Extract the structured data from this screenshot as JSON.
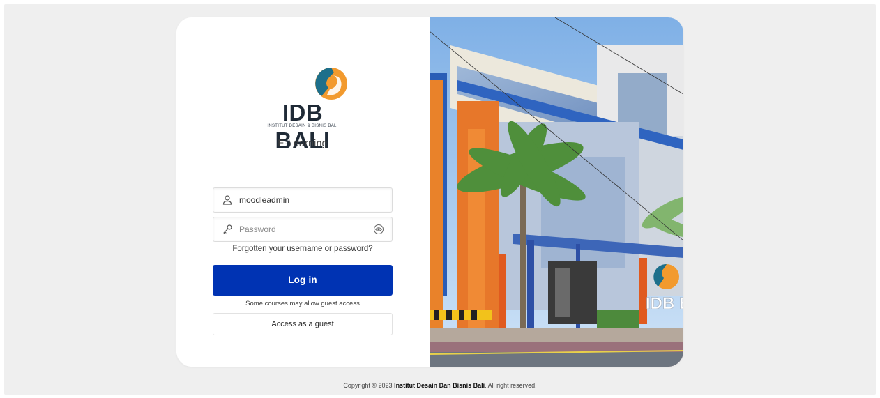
{
  "brand": {
    "title": "IDB BALI",
    "subtitle": "INSTITUT DESAIN & BISNIS BALI",
    "app_name": "E-Learning",
    "colors": {
      "primary_button": "#0033b3",
      "logo_teal": "#1d6f8b",
      "logo_orange": "#f29a2e"
    }
  },
  "login_form": {
    "username": {
      "value": "moodleadmin",
      "icon": "user-icon"
    },
    "password": {
      "placeholder": "Password",
      "icon": "key-icon",
      "toggle_icon": "eye-icon"
    },
    "forgot_link": "Forgotten your username or password?",
    "login_button": "Log in",
    "guest_note": "Some courses may allow guest access",
    "guest_button": "Access as a guest"
  },
  "hero_image": {
    "building_sign": "IDB BALI"
  },
  "footer": {
    "prefix": "Copyright © 2023 ",
    "org": "Institut Desain Dan Bisnis Bali",
    "suffix": ". All right reserved."
  }
}
